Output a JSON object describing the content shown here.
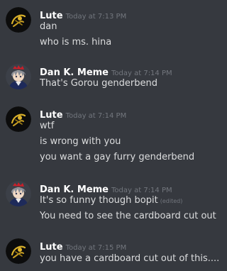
{
  "colors": {
    "background": "#36393f",
    "username": "#ffffff",
    "text": "#dcddde",
    "muted": "#72767d"
  },
  "messages": [
    {
      "author": "Lute",
      "avatar": "lute-avatar-icon",
      "time": "Today at 7:13 PM",
      "lines": [
        {
          "text": "dan"
        },
        {
          "text": "who is ms. hina"
        }
      ]
    },
    {
      "author": "Dan K. Meme",
      "avatar": "dan-avatar-icon",
      "time": "Today at 7:14 PM",
      "lines": [
        {
          "text": "That's Gorou genderbend"
        }
      ]
    },
    {
      "author": "Lute",
      "avatar": "lute-avatar-icon",
      "time": "Today at 7:14 PM",
      "lines": [
        {
          "text": "wtf"
        },
        {
          "text": "is wrong with you"
        },
        {
          "text": "you want a gay furry genderbend"
        }
      ]
    },
    {
      "author": "Dan K. Meme",
      "avatar": "dan-avatar-icon",
      "time": "Today at 7:14 PM",
      "lines": [
        {
          "text": "It's so funny though bopit",
          "edited": "(edited)"
        },
        {
          "text": "You need to see the cardboard cut out"
        }
      ]
    },
    {
      "author": "Lute",
      "avatar": "lute-avatar-icon",
      "time": "Today at 7:15 PM",
      "lines": [
        {
          "text": "you have a cardboard cut out of this...."
        }
      ]
    }
  ]
}
